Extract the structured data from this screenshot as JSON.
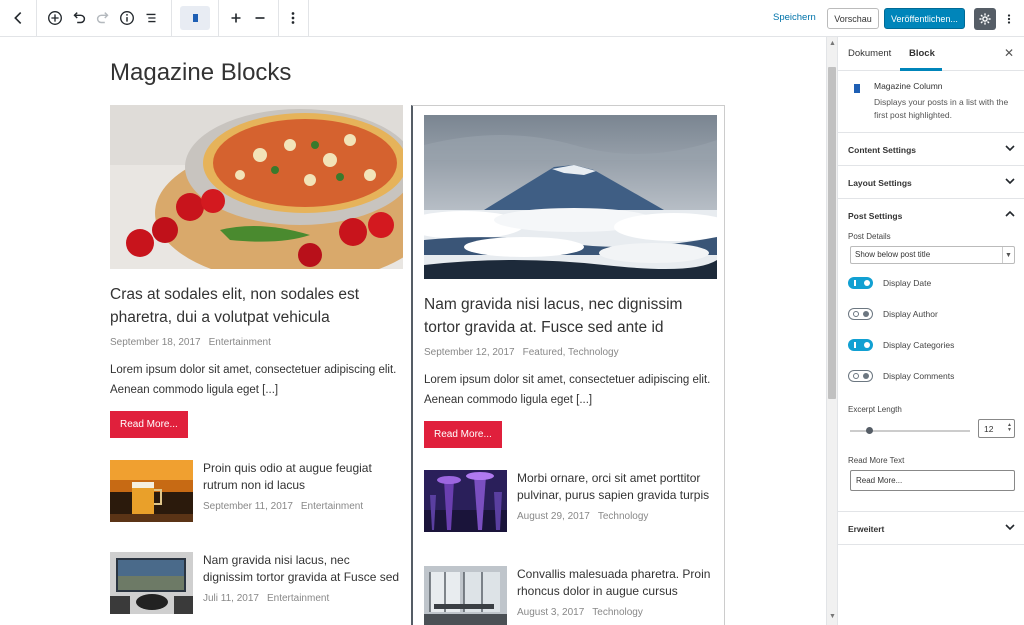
{
  "toolbar": {
    "save_label": "Speichern",
    "preview_label": "Vorschau",
    "publish_label": "Veröffentlichen..."
  },
  "editor": {
    "page_title": "Magazine Blocks",
    "left_column": {
      "featured": {
        "title": "Cras at sodales elit, non sodales est pharetra, dui a volutpat vehicula",
        "date": "September 18, 2017",
        "category": "Entertainment",
        "excerpt": "Lorem ipsum dolor sit amet, consectetuer adipiscing elit. Aenean commodo ligula eget [...]",
        "read_more": "Read More..."
      },
      "posts": [
        {
          "title": "Proin quis odio at augue feugiat rutrum non id lacus",
          "date": "September 11, 2017",
          "category": "Entertainment"
        },
        {
          "title": "Nam gravida nisi lacus, nec dignissim tortor gravida at Fusce sed",
          "date": "Juli 11, 2017",
          "category": "Entertainment"
        }
      ]
    },
    "right_column": {
      "featured": {
        "title": "Nam gravida nisi lacus, nec dignissim tortor gravida at. Fusce sed ante id",
        "date": "September 12, 2017",
        "category": "Featured, Technology",
        "excerpt": "Lorem ipsum dolor sit amet, consectetuer adipiscing elit. Aenean commodo ligula eget [...]",
        "read_more": "Read More..."
      },
      "posts": [
        {
          "title": "Morbi ornare, orci sit amet porttitor pulvinar, purus sapien gravida turpis",
          "date": "August 29, 2017",
          "category": "Technology"
        },
        {
          "title": "Convallis malesuada pharetra. Proin rhoncus dolor in augue cursus",
          "date": "August 3, 2017",
          "category": "Technology"
        }
      ]
    }
  },
  "sidebar": {
    "tabs": [
      {
        "label": "Dokument"
      },
      {
        "label": "Block"
      }
    ],
    "active_tab": "Block",
    "block": {
      "name": "Magazine Column",
      "description": "Displays your posts in a list with the first post highlighted."
    },
    "panels": {
      "content_settings": "Content Settings",
      "layout_settings": "Layout Settings",
      "post_settings": "Post Settings",
      "advanced": "Erweitert"
    },
    "post_settings": {
      "post_details_label": "Post Details",
      "post_details_value": "Show below post title",
      "toggles": [
        {
          "label": "Display Date",
          "on": true
        },
        {
          "label": "Display Author",
          "on": false
        },
        {
          "label": "Display Categories",
          "on": true
        },
        {
          "label": "Display Comments",
          "on": false
        }
      ],
      "excerpt_length_label": "Excerpt Length",
      "excerpt_length_value": "12",
      "read_more_text_label": "Read More Text",
      "read_more_text_value": "Read More..."
    }
  },
  "colors": {
    "accent_blue": "#0085ba",
    "read_more_red": "#e0203c",
    "toggle_on": "#11a0d2"
  }
}
